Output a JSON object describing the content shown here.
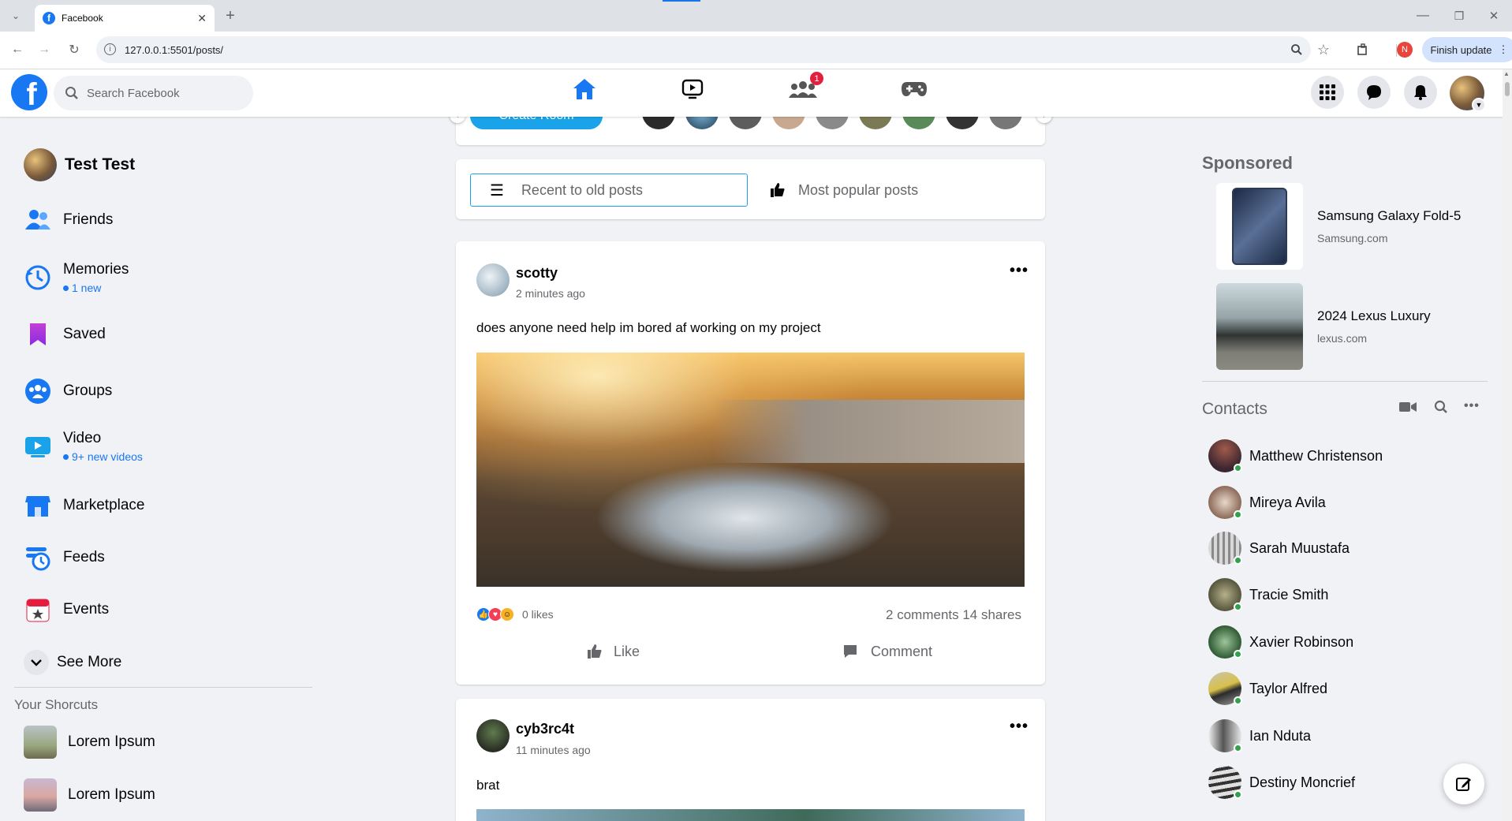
{
  "browser": {
    "tab_title": "Facebook",
    "url": "127.0.0.1:5501/posts/",
    "profile_initial": "N",
    "finish_update": "Finish update"
  },
  "header": {
    "search_placeholder": "Search Facebook",
    "groups_badge": "1"
  },
  "user": {
    "name": "Test Test"
  },
  "sidebar": {
    "items": [
      {
        "label": "Friends",
        "sub": ""
      },
      {
        "label": "Memories",
        "sub": "1 new"
      },
      {
        "label": "Saved",
        "sub": ""
      },
      {
        "label": "Groups",
        "sub": ""
      },
      {
        "label": "Video",
        "sub": "9+ new videos"
      },
      {
        "label": "Marketplace",
        "sub": ""
      },
      {
        "label": "Feeds",
        "sub": ""
      },
      {
        "label": "Events",
        "sub": ""
      }
    ],
    "see_more": "See More",
    "shortcuts_title": "Your Shorcuts",
    "shortcuts": [
      "Lorem Ipsum",
      "Lorem Ipsum"
    ]
  },
  "rooms": {
    "create_room": "Create Room"
  },
  "sort": {
    "recent": "Recent to old posts",
    "popular": "Most popular posts"
  },
  "posts": [
    {
      "author": "scotty",
      "time": "2 minutes ago",
      "text": "does anyone need help im bored af working on my project",
      "likes": "0 likes",
      "stats": "2 comments 14 shares",
      "like_label": "Like",
      "comment_label": "Comment"
    },
    {
      "author": "cyb3rc4t",
      "time": "11 minutes ago",
      "text": "brat"
    }
  ],
  "sponsored": {
    "title": "Sponsored",
    "ads": [
      {
        "name": "Samsung Galaxy Fold-5",
        "site": "Samsung.com"
      },
      {
        "name": "2024 Lexus Luxury",
        "site": "lexus.com"
      }
    ]
  },
  "contacts": {
    "title": "Contacts",
    "list": [
      "Matthew Christenson",
      "Mireya Avila",
      "Sarah Muustafa",
      "Tracie Smith",
      "Xavier Robinson",
      "Taylor Alfred",
      "Ian Nduta",
      "Destiny Moncrief"
    ]
  },
  "colors": {
    "brand": "#1877f2",
    "online": "#31a24c",
    "reaction_like": "#1877f2",
    "reaction_love": "#f33e58",
    "reaction_haha": "#f7b125"
  },
  "icons": [
    "home-icon",
    "watch-icon",
    "groups-icon",
    "gaming-icon",
    "menu-grid-icon",
    "messenger-icon",
    "bell-icon",
    "search-icon",
    "video-call-icon",
    "more-icon",
    "compose-icon"
  ]
}
